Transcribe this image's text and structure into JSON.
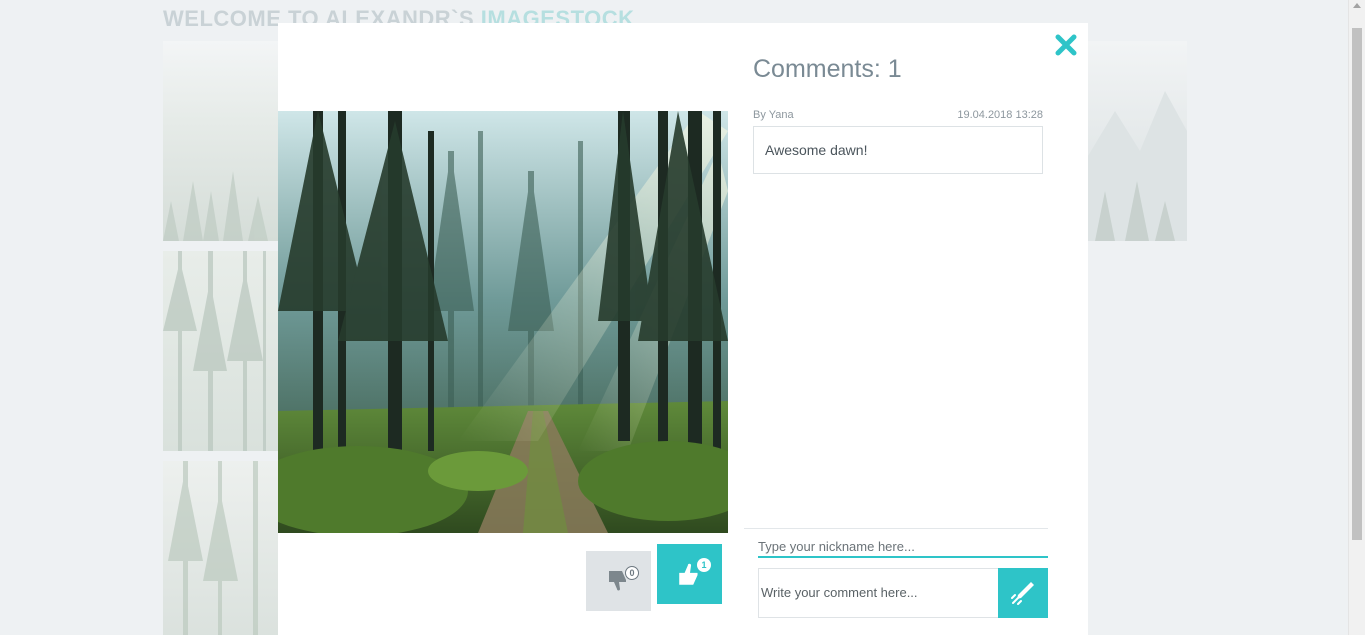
{
  "background": {
    "title_part1": "WELCOME TO ALEXANDR`S ",
    "title_part2": "IMAGESTOCK"
  },
  "modal": {
    "comments_title": "Comments: 1",
    "comments": [
      {
        "author": "By Yana",
        "date": "19.04.2018 13:28",
        "text": "Awesome dawn!"
      }
    ],
    "dislike_count": "0",
    "like_count": "1",
    "nickname_placeholder": "Type your nickname here...",
    "comment_placeholder": "Write your comment here...",
    "accent_color": "#2ec4c8"
  },
  "icons": [
    "close-icon",
    "thumbs-down-icon",
    "thumbs-up-icon",
    "send-icon"
  ]
}
